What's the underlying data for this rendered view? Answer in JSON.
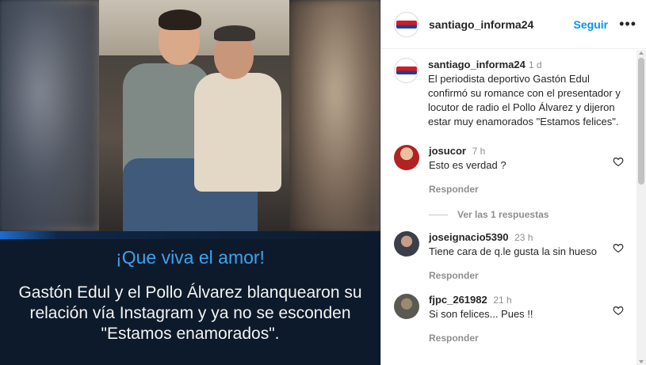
{
  "post": {
    "account": "santiago_informa24",
    "follow_label": "Seguir",
    "more_label": "•••",
    "media": {
      "headline": "¡Que viva el amor!",
      "subtitle": "Gastón Edul y el Pollo Álvarez blanquearon su relación vía Instagram y ya no se esconden \"Estamos enamorados\"."
    },
    "caption": {
      "username": "santiago_informa24",
      "time": "1 d",
      "text": "El periodista deportivo Gastón Edul confirmó su romance con el presentador y locutor de radio el Pollo Álvarez y dijeron estar muy enamorados \"Estamos felices\"."
    }
  },
  "comments": [
    {
      "username": "josucor",
      "time": "7 h",
      "text": "Esto es verdad ?",
      "reply_label": "Responder",
      "avatar_color": "#b22222"
    },
    {
      "username": "joseignacio5390",
      "time": "23 h",
      "text": "Tiene cara de q.le gusta la sin hueso",
      "reply_label": "Responder",
      "avatar_color": "#3a3f4a"
    },
    {
      "username": "fjpc_261982",
      "time": "21 h",
      "text": "Si son felices... Pues !!",
      "reply_label": "Responder",
      "avatar_color": "#5a5a52"
    }
  ],
  "view_replies_label": "Ver las 1 respuestas",
  "colors": {
    "accent": "#0095f6",
    "headline": "#3ea2ee",
    "media_bg": "#0d1a2b"
  },
  "icons": [
    "heart-icon",
    "more-icon",
    "avatar-logo"
  ]
}
